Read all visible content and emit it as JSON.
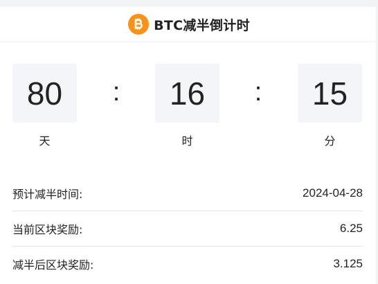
{
  "header": {
    "title": "BTC减半倒计时",
    "icon": "bitcoin-icon",
    "icon_color": "#f7931a"
  },
  "countdown": {
    "days": "80",
    "days_label": "天",
    "hours": "16",
    "hours_label": "时",
    "minutes": "15",
    "minutes_label": "分",
    "separator": ":"
  },
  "info": {
    "rows": [
      {
        "label": "预计减半时间:",
        "value": "2024-04-28"
      },
      {
        "label": "当前区块奖励:",
        "value": "6.25"
      },
      {
        "label": "减半后区块奖励:",
        "value": "3.125"
      }
    ]
  }
}
